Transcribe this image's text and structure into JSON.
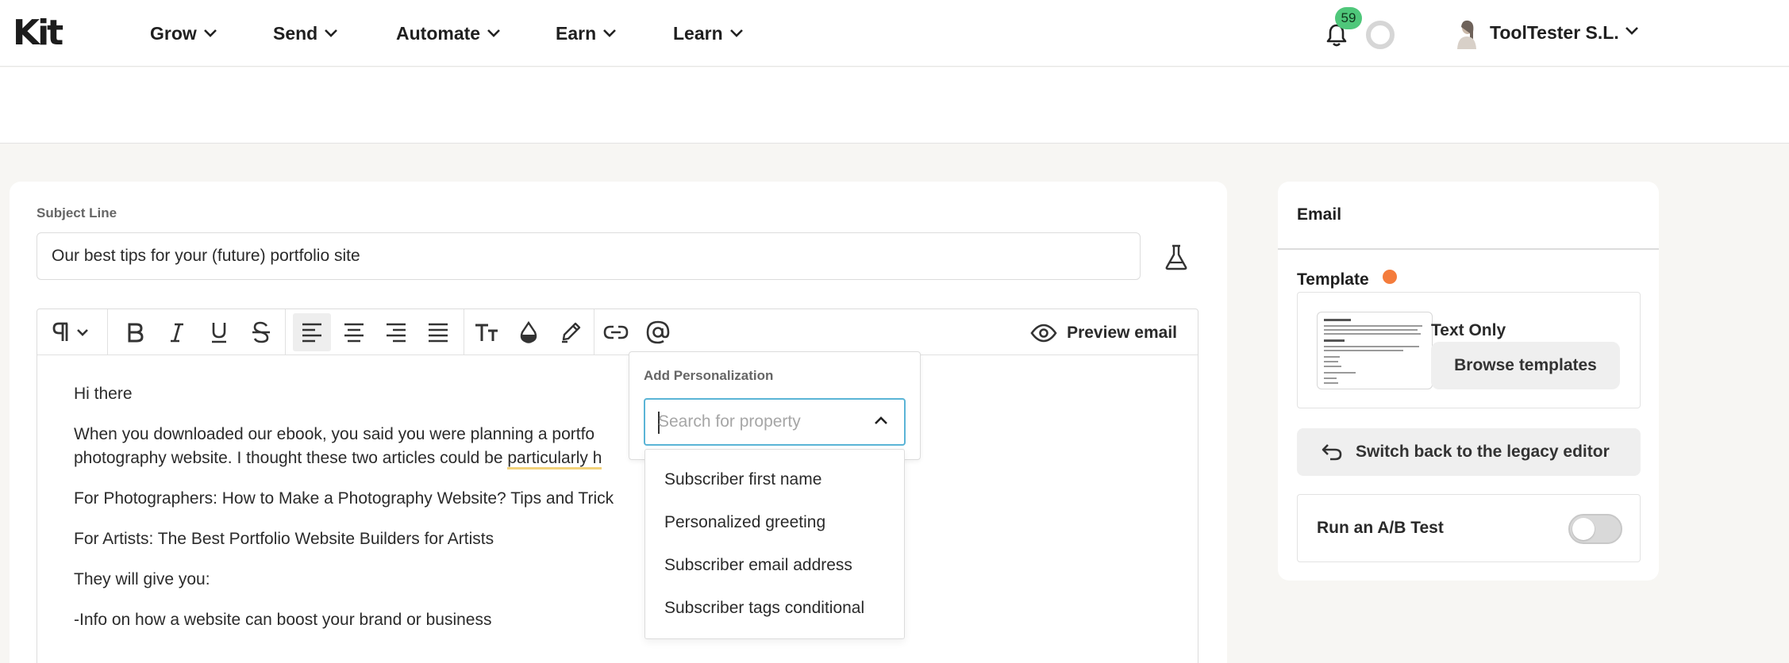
{
  "app": {
    "logo": "Kit"
  },
  "nav": [
    {
      "label": "Grow"
    },
    {
      "label": "Send"
    },
    {
      "label": "Automate"
    },
    {
      "label": "Earn"
    },
    {
      "label": "Learn"
    }
  ],
  "notifications": {
    "count": "59"
  },
  "user": {
    "name": "ToolTester S.L."
  },
  "email": {
    "subject_label": "Subject Line",
    "subject_value": "Our best tips for your (future) portfolio site",
    "preview_label": "Preview email",
    "body": {
      "line1": "Hi there",
      "line2": "When you downloaded our ebook, you said you were planning a portfo",
      "line3_a": "photography website. I thought these two articles could be ",
      "line3_b": "particularly h",
      "line4": "For Photographers: How to Make a Photography Website? Tips and Trick",
      "line5": "For Artists: The Best Portfolio Website Builders for Artists",
      "line6": "They will give you:",
      "line7": "-Info on how a website can boost your brand or business"
    }
  },
  "personalization": {
    "title": "Add Personalization",
    "search_placeholder": "Search for property",
    "options": [
      {
        "label": "Subscriber first name"
      },
      {
        "label": "Personalized greeting"
      },
      {
        "label": "Subscriber email address"
      },
      {
        "label": "Subscriber tags conditional"
      }
    ]
  },
  "sidebar": {
    "title": "Email",
    "template_label": "Template",
    "template_name": "Text Only",
    "browse_label": "Browse templates",
    "legacy_label": "Switch back to the legacy editor",
    "ab_label": "Run an A/B Test",
    "ab_enabled": false
  },
  "colors": {
    "badge": "#4fc77a",
    "template_dot": "#f47c3c",
    "search_focus": "#5ab4d6"
  }
}
